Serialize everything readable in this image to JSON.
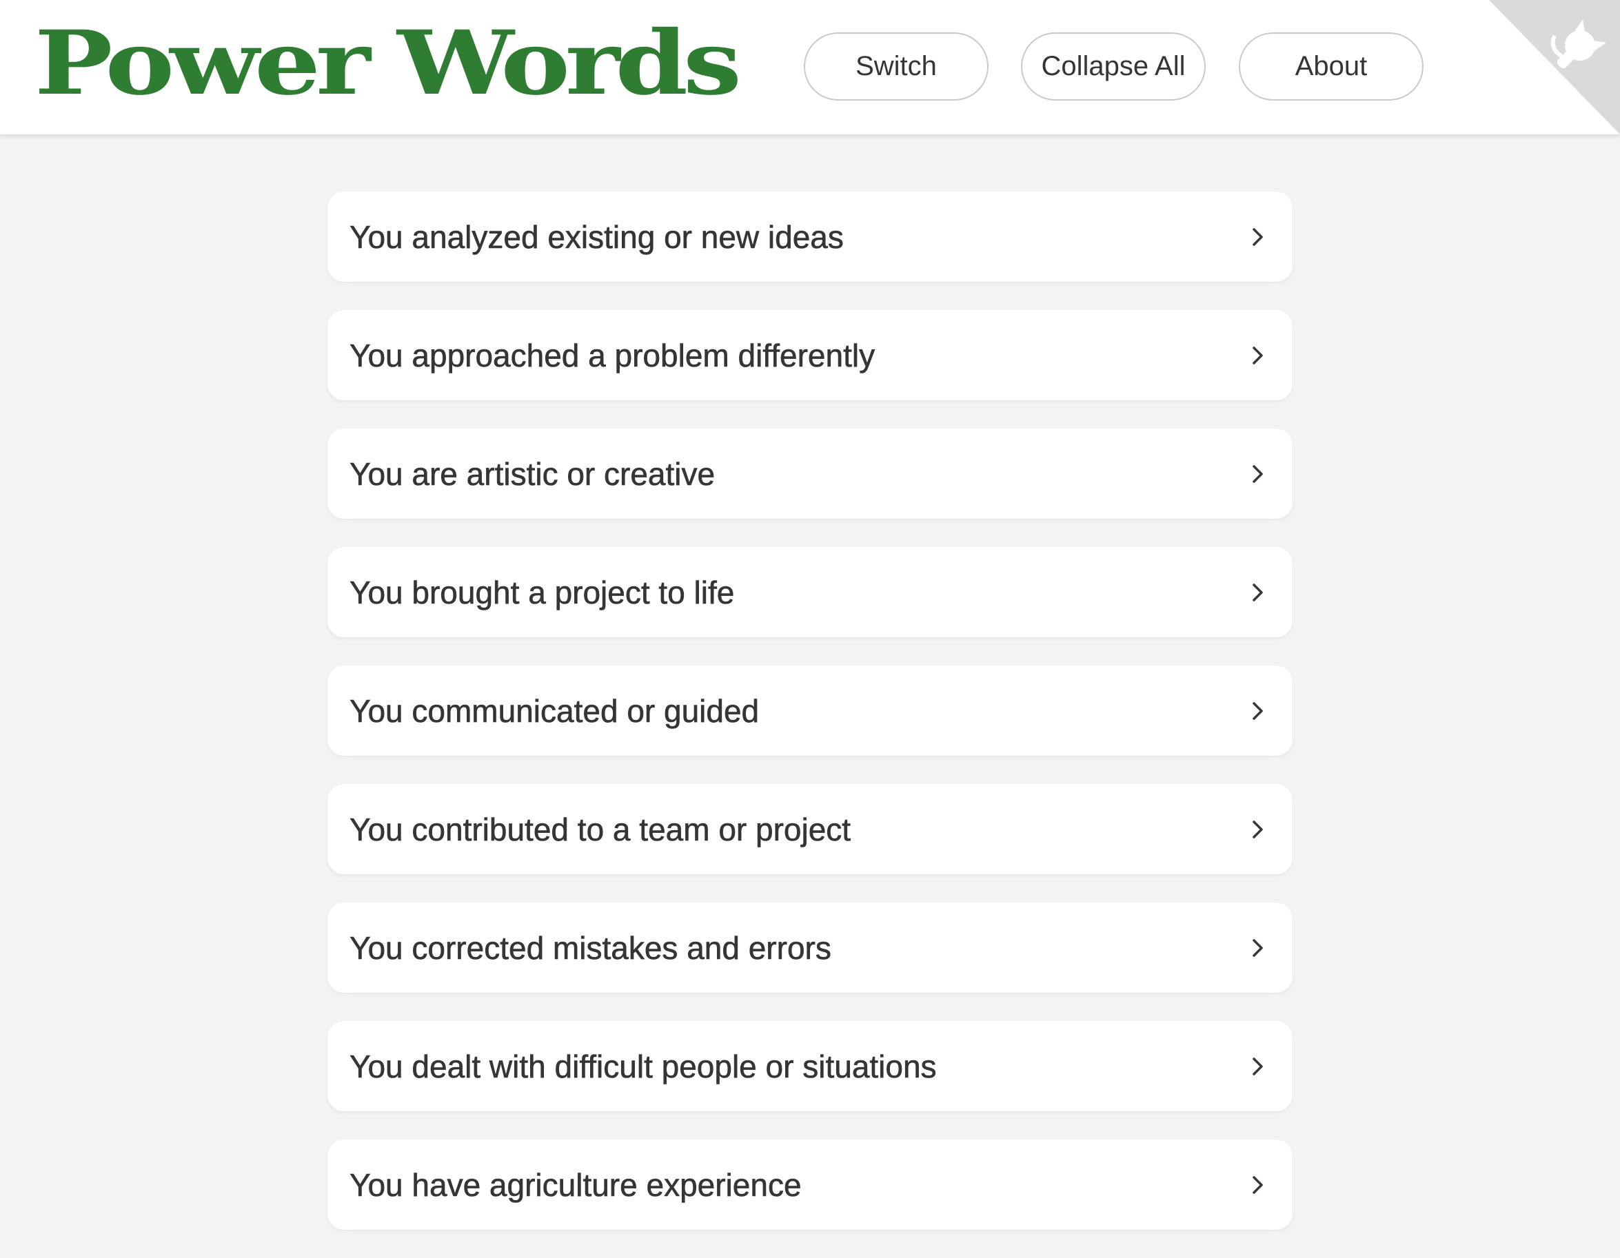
{
  "header": {
    "logo_text": "Power Words",
    "nav": [
      {
        "label": "Switch"
      },
      {
        "label": "Collapse All"
      },
      {
        "label": "About"
      }
    ],
    "corner_icon": "github-octocat-icon"
  },
  "colors": {
    "brand_green": "#2f7d32",
    "text": "#353535",
    "background": "#f2f3f2",
    "card": "#ffffff",
    "corner": "#d9dad9"
  },
  "items": [
    {
      "label": "You analyzed existing or new ideas",
      "icon": "chevron-right-icon"
    },
    {
      "label": "You approached a problem differently",
      "icon": "chevron-right-icon"
    },
    {
      "label": "You are artistic or creative",
      "icon": "chevron-right-icon"
    },
    {
      "label": "You brought a project to life",
      "icon": "chevron-right-icon"
    },
    {
      "label": "You communicated or guided",
      "icon": "chevron-right-icon"
    },
    {
      "label": "You contributed to a team or project",
      "icon": "chevron-right-icon"
    },
    {
      "label": "You corrected mistakes and errors",
      "icon": "chevron-right-icon"
    },
    {
      "label": "You dealt with difficult people or situations",
      "icon": "chevron-right-icon"
    },
    {
      "label": "You have agriculture experience",
      "icon": "chevron-right-icon"
    }
  ]
}
